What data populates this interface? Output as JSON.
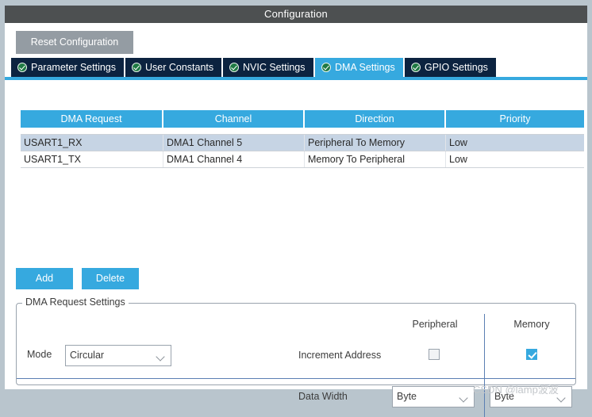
{
  "window": {
    "title": "Configuration"
  },
  "toolbar": {
    "reset_label": "Reset Configuration"
  },
  "tabs": [
    {
      "label": "Parameter Settings",
      "icon": "green-check-icon",
      "active": false
    },
    {
      "label": "User Constants",
      "icon": "green-check-icon",
      "active": false
    },
    {
      "label": "NVIC Settings",
      "icon": "green-check-icon",
      "active": false
    },
    {
      "label": "DMA Settings",
      "icon": "green-check-icon",
      "active": true
    },
    {
      "label": "GPIO Settings",
      "icon": "green-check-icon",
      "active": false
    }
  ],
  "table": {
    "columns": [
      "DMA Request",
      "Channel",
      "Direction",
      "Priority"
    ],
    "rows": [
      {
        "selected": true,
        "cells": [
          "USART1_RX",
          "DMA1 Channel 5",
          "Peripheral To Memory",
          "Low"
        ]
      },
      {
        "selected": false,
        "cells": [
          "USART1_TX",
          "DMA1 Channel 4",
          "Memory To Peripheral",
          "Low"
        ]
      }
    ]
  },
  "actions": {
    "add_label": "Add",
    "delete_label": "Delete"
  },
  "group": {
    "title": "DMA Request Settings",
    "column_headers": {
      "peripheral": "Peripheral",
      "memory": "Memory"
    },
    "mode": {
      "label": "Mode",
      "value": "Circular"
    },
    "increment_address": {
      "label": "Increment Address",
      "peripheral_checked": false,
      "memory_checked": true
    },
    "data_width": {
      "label": "Data Width",
      "peripheral_value": "Byte",
      "memory_value": "Byte"
    }
  },
  "watermark": {
    "text": "CSDN @lamp波波"
  },
  "colors": {
    "accent_blue": "#36a9df",
    "tab_inactive": "#0c2340",
    "titlebar": "#4d5051",
    "window_border": "#b9c5cd",
    "row_selected": "#c6d4e4",
    "disabled_button": "#949ca3",
    "divider_blue": "#5b7fb3"
  }
}
